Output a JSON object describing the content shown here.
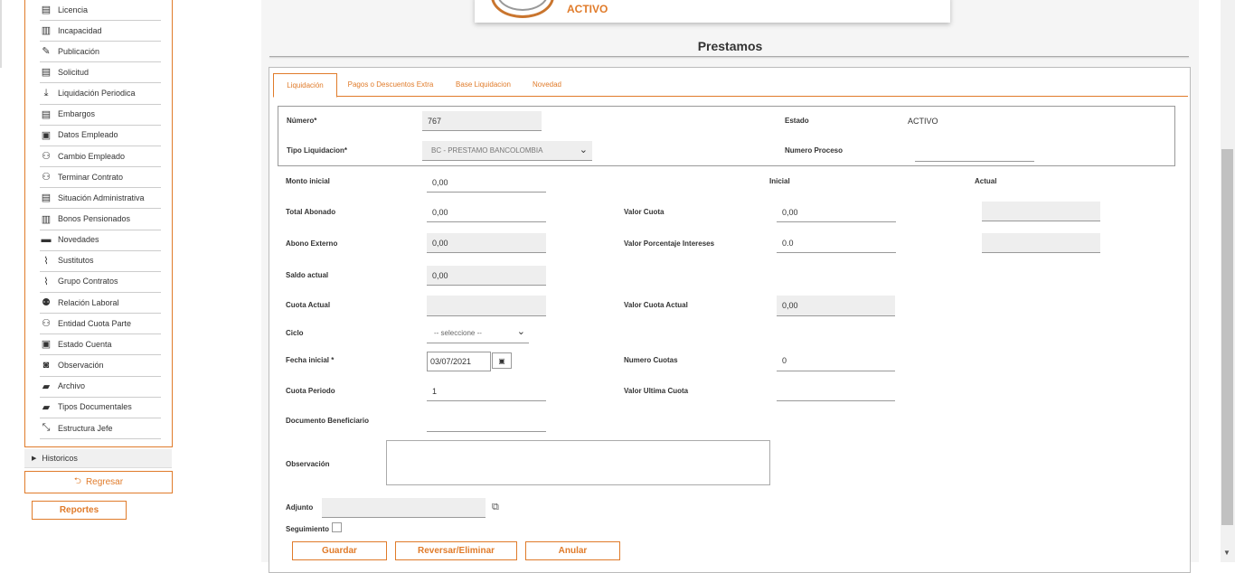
{
  "sidebar": {
    "items": [
      {
        "label": "Licencia",
        "icon": "list-icon"
      },
      {
        "label": "Incapacidad",
        "icon": "book-icon"
      },
      {
        "label": "Publicación",
        "icon": "pencil-icon"
      },
      {
        "label": "Solicitud",
        "icon": "document-icon"
      },
      {
        "label": "Liquidación Periodica",
        "icon": "download-icon"
      },
      {
        "label": "Embargos",
        "icon": "list-icon"
      },
      {
        "label": "Datos Empleado",
        "icon": "id-card-icon"
      },
      {
        "label": "Cambio Empleado",
        "icon": "user-plus-icon"
      },
      {
        "label": "Terminar Contrato",
        "icon": "user-remove-icon"
      },
      {
        "label": "Situación Administrativa",
        "icon": "file-icon"
      },
      {
        "label": "Bonos Pensionados",
        "icon": "copy-icon"
      },
      {
        "label": "Novedades",
        "icon": "comment-icon"
      },
      {
        "label": "Sustitutos",
        "icon": "paperclip-icon"
      },
      {
        "label": "Grupo Contratos",
        "icon": "paperclip-icon"
      },
      {
        "label": "Relación Laboral",
        "icon": "users-icon"
      },
      {
        "label": "Entidad Cuota Parte",
        "icon": "group-icon"
      },
      {
        "label": "Estado Cuenta",
        "icon": "statement-icon"
      },
      {
        "label": "Observación",
        "icon": "camera-icon"
      },
      {
        "label": "Archivo",
        "icon": "folder-open-icon"
      },
      {
        "label": "Tipos Documentales",
        "icon": "folder-open-icon"
      },
      {
        "label": "Estructura Jefe",
        "icon": "hierarchy-icon"
      }
    ],
    "historicos": "Historicos",
    "regresar": "Regresar",
    "reportes": "Reportes"
  },
  "status": {
    "text": "ACTIVO"
  },
  "page": {
    "title": "Prestamos"
  },
  "tabs": [
    {
      "label": "Liquidación",
      "active": true
    },
    {
      "label": "Pagos o Descuentos Extra",
      "active": false
    },
    {
      "label": "Base Liquidacion",
      "active": false
    },
    {
      "label": "Novedad",
      "active": false
    }
  ],
  "form": {
    "numero_label": "Número*",
    "numero_value": "767",
    "estado_label": "Estado",
    "estado_value": "ACTIVO",
    "tipo_label": "Tipo Liquidacion*",
    "tipo_value": "BC - PRESTAMO BANCOLOMBIA",
    "numero_proceso_label": "Numero Proceso",
    "numero_proceso_value": "",
    "monto_inicial_label": "Monto inicial",
    "monto_inicial_value": "0,00",
    "inicial_header": "Inicial",
    "actual_header": "Actual",
    "total_abonado_label": "Total Abonado",
    "total_abonado_value": "0,00",
    "valor_cuota_label": "Valor Cuota",
    "valor_cuota_inicial": "0,00",
    "valor_cuota_actual": "",
    "abono_externo_label": "Abono Externo",
    "abono_externo_value": "0,00",
    "valor_porcentaje_label": "Valor Porcentaje Intereses",
    "valor_porcentaje_inicial": "0.0",
    "valor_porcentaje_actual": "",
    "saldo_actual_label": "Saldo actual",
    "saldo_actual_value": "0,00",
    "cuota_actual_label": "Cuota Actual",
    "cuota_actual_value": "",
    "valor_cuota_actual_label": "Valor Cuota Actual",
    "valor_cuota_actual_value": "0,00",
    "ciclo_label": "Ciclo",
    "ciclo_value": "-- seleccione --",
    "fecha_inicial_label": "Fecha inicial *",
    "fecha_inicial_value": "03/07/2021",
    "numero_cuotas_label": "Numero Cuotas",
    "numero_cuotas_value": "0",
    "cuota_periodo_label": "Cuota Periodo",
    "cuota_periodo_value": "1",
    "valor_ultima_cuota_label": "Valor Ultima Cuota",
    "valor_ultima_cuota_value": "",
    "documento_beneficiario_label": "Documento Beneficiario",
    "documento_beneficiario_value": "",
    "observacion_label": "Observación",
    "adjunto_label": "Adjunto",
    "seguimiento_label": "Seguimiento"
  },
  "actions": {
    "guardar": "Guardar",
    "reversar": "Reversar/Eliminar",
    "anular": "Anular"
  },
  "colors": {
    "accent": "#e07b2a"
  }
}
